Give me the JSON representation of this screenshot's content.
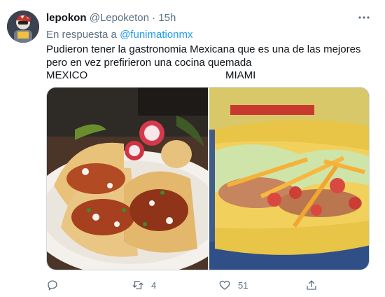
{
  "author": {
    "name": "lepokon",
    "handle": "@Lepoketon",
    "separator": "·",
    "time": "15h"
  },
  "reply": {
    "prefix": "En respuesta a",
    "mention": "@funimationmx"
  },
  "text": "Pudieron tener la gastronomia Mexicana que es una de las mejores pero en vez prefirieron una cocina quemada",
  "labels": {
    "left": "MEXICO",
    "right": "MIAMI"
  },
  "actions": {
    "reply_count": "",
    "retweet_count": "4",
    "like_count": "51"
  },
  "icons": [
    "more-icon",
    "reply-icon",
    "retweet-icon",
    "like-icon",
    "share-icon"
  ],
  "colors": {
    "accent": "#1d9bf0",
    "muted": "#5b7083"
  }
}
